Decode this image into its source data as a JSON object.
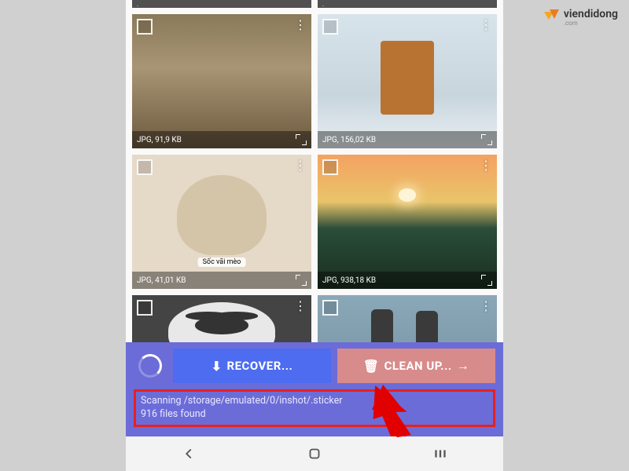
{
  "watermark": {
    "text": "viendidong",
    "sub": ".com"
  },
  "thumbs": {
    "top_left_info": "JPG, 91,9 KB",
    "top_right_info": "JPG, 156,02 KB",
    "cat_info": "JPG, 41,01 KB",
    "cat_caption": "Sốc vãi mèo",
    "sunset_info": "JPG, 938,18 KB"
  },
  "buttons": {
    "recover": "RECOVER...",
    "clean": "CLEAN UP..."
  },
  "status": {
    "line1": "Scanning /storage/emulated/0/inshot/.sticker",
    "line2": "916 files found"
  }
}
